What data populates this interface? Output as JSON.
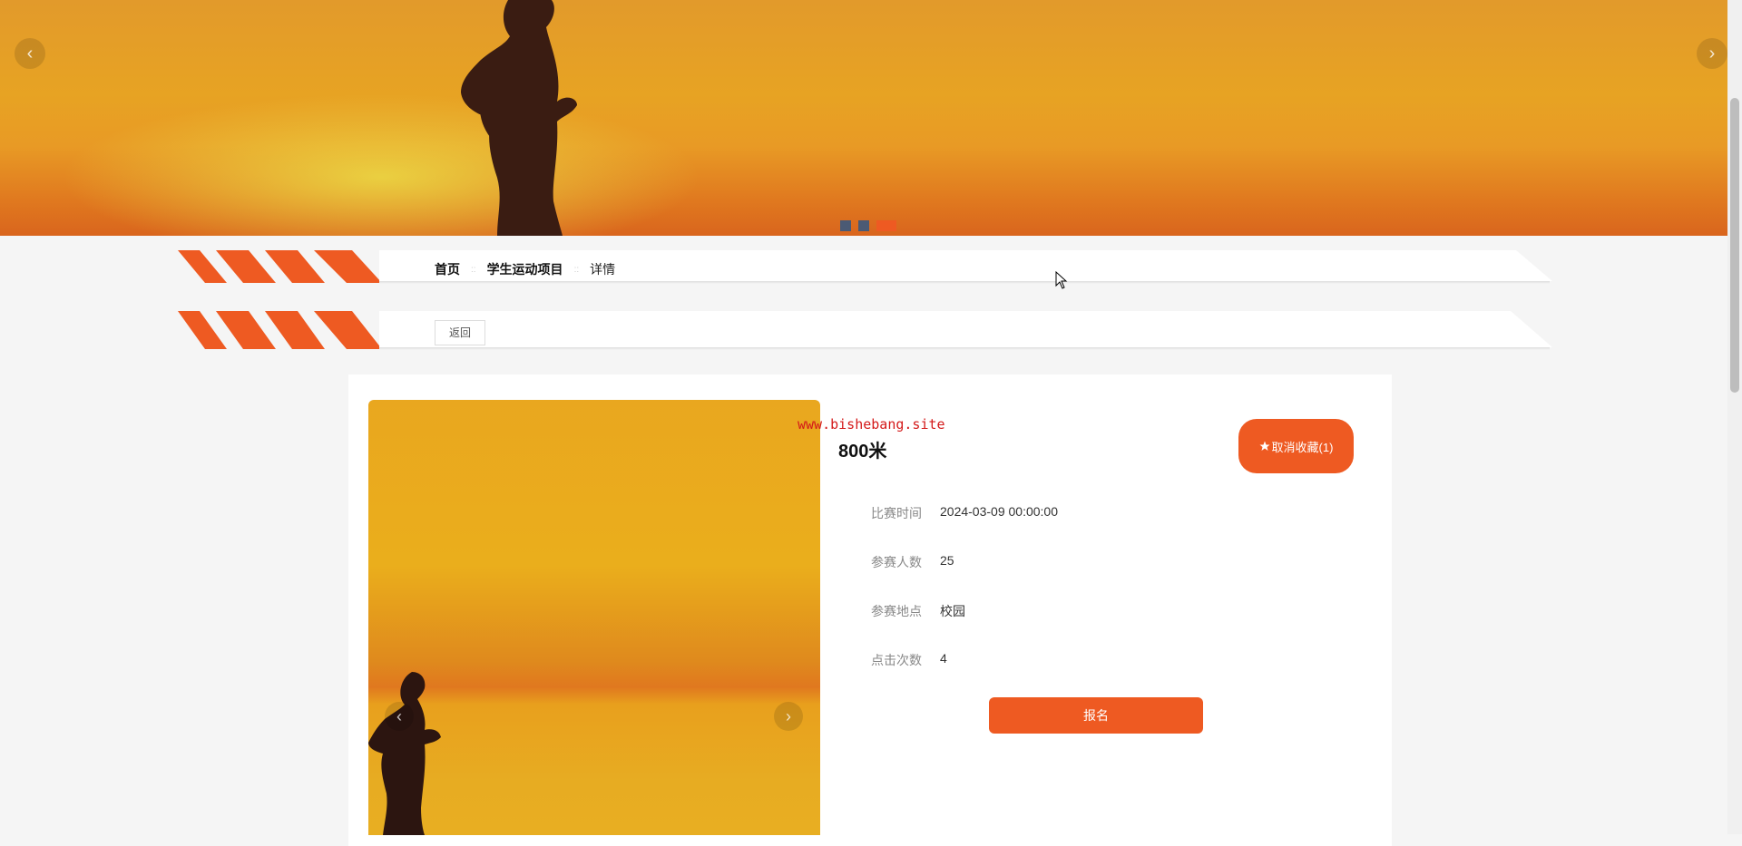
{
  "banner": {
    "prev_icon": "‹",
    "next_icon": "›",
    "slides": 3,
    "active_slide": 3
  },
  "breadcrumb": {
    "items": [
      "首页",
      "学生运动项目",
      "详情"
    ],
    "separator": "::"
  },
  "back_button": "返回",
  "watermark": "www.bishebang.site",
  "detail": {
    "title": "800米",
    "favorite_button": "取消收藏(1)",
    "favorite_icon": "star-icon",
    "fields": [
      {
        "label": "比赛时间",
        "value": "2024-03-09 00:00:00"
      },
      {
        "label": "参赛人数",
        "value": "25"
      },
      {
        "label": "参赛地点",
        "value": "校园"
      },
      {
        "label": "点击次数",
        "value": "4"
      }
    ],
    "signup_button": "报名"
  },
  "gallery": {
    "prev_icon": "‹",
    "next_icon": "›"
  },
  "colors": {
    "accent": "#ee5a22",
    "dot_inactive": "#4b5a74",
    "watermark": "#d41a1a"
  }
}
